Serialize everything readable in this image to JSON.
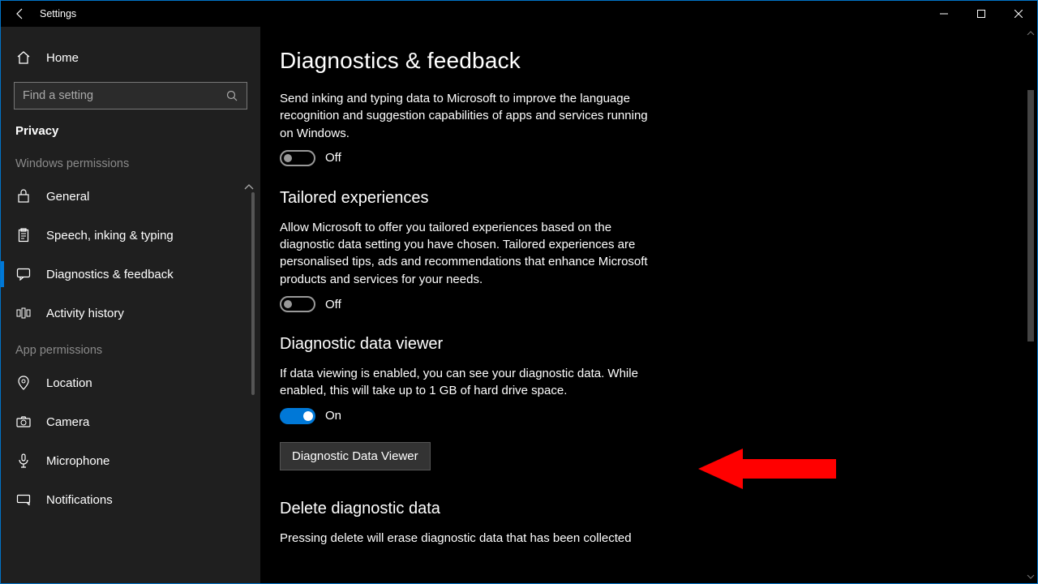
{
  "window": {
    "title": "Settings"
  },
  "sidebar": {
    "home": "Home",
    "search_placeholder": "Find a setting",
    "section": "Privacy",
    "group_win": "Windows permissions",
    "items_win": [
      {
        "label": "General"
      },
      {
        "label": "Speech, inking & typing"
      },
      {
        "label": "Diagnostics & feedback"
      },
      {
        "label": "Activity history"
      }
    ],
    "group_app": "App permissions",
    "items_app": [
      {
        "label": "Location"
      },
      {
        "label": "Camera"
      },
      {
        "label": "Microphone"
      },
      {
        "label": "Notifications"
      }
    ]
  },
  "main": {
    "title": "Diagnostics & feedback",
    "inking_desc": "Send inking and typing data to Microsoft to improve the language recognition and suggestion capabilities of apps and services running on Windows.",
    "inking_state": "Off",
    "tailored_head": "Tailored experiences",
    "tailored_desc": "Allow Microsoft to offer you tailored experiences based on the diagnostic data setting you have chosen. Tailored experiences are personalised tips, ads and recommendations that enhance Microsoft products and services for your needs.",
    "tailored_state": "Off",
    "viewer_head": "Diagnostic data viewer",
    "viewer_desc": "If data viewing is enabled, you can see your diagnostic data. While enabled, this will take up to 1 GB of hard drive space.",
    "viewer_state": "On",
    "viewer_button": "Diagnostic Data Viewer",
    "delete_head": "Delete diagnostic data",
    "delete_desc": "Pressing delete will erase diagnostic data that has been collected"
  }
}
